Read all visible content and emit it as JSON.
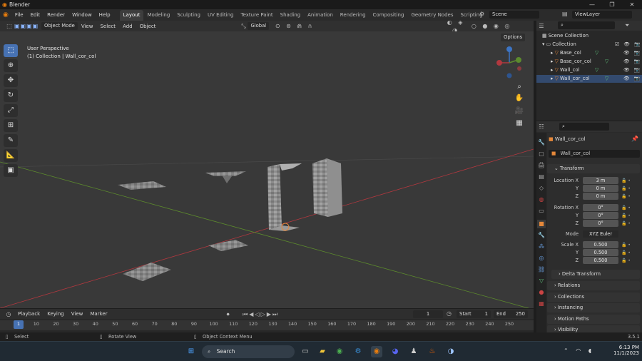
{
  "window": {
    "title": "Blender",
    "minimize": "—",
    "maximize": "❐",
    "close": "✕"
  },
  "menu": {
    "items": [
      "File",
      "Edit",
      "Render",
      "Window",
      "Help"
    ]
  },
  "workspaces": {
    "tabs": [
      "Layout",
      "Modeling",
      "Sculpting",
      "UV Editing",
      "Texture Paint",
      "Shading",
      "Animation",
      "Rendering",
      "Compositing",
      "Geometry Nodes",
      "Scripting"
    ],
    "active": "Layout",
    "add": "+"
  },
  "scene": {
    "name": "Scene",
    "view_layer": "ViewLayer"
  },
  "viewport_header": {
    "mode": "Object Mode",
    "menus": [
      "View",
      "Select",
      "Add",
      "Object"
    ],
    "orientation": "Global",
    "options": "Options"
  },
  "viewport": {
    "perspective": "User Perspective",
    "collection_info": "(1) Collection | Wall_cor_col",
    "gizmo_labels": {
      "z": "Z",
      "y": "Y",
      "x": "X"
    }
  },
  "outliner": {
    "root": "Scene Collection",
    "collection": "Collection",
    "objects": [
      "Base_col",
      "Base_cor_col",
      "Wall_col",
      "Wall_cor_col"
    ]
  },
  "properties": {
    "object_name": "Wall_cor_col",
    "object_field": "Wall_cor_col",
    "transform": {
      "title": "Transform",
      "location": {
        "label": "Location",
        "axes": [
          "X",
          "Y",
          "Z"
        ],
        "values": [
          "3 m",
          "0 m",
          "0 m"
        ]
      },
      "rotation": {
        "label": "Rotation",
        "axes": [
          "X",
          "Y",
          "Z"
        ],
        "values": [
          "0°",
          "0°",
          "0°"
        ]
      },
      "mode": {
        "label": "Mode",
        "value": "XYZ Euler"
      },
      "scale": {
        "label": "Scale",
        "axes": [
          "X",
          "Y",
          "Z"
        ],
        "values": [
          "0.500",
          "0.500",
          "0.500"
        ]
      }
    },
    "delta_transform": "Delta Transform",
    "panels": [
      "Relations",
      "Collections",
      "Instancing",
      "Motion Paths",
      "Visibility"
    ]
  },
  "timeline": {
    "menus": [
      "Playback",
      "Keying",
      "View",
      "Marker"
    ],
    "current_frame": "1",
    "start_label": "Start",
    "start": "1",
    "end_label": "End",
    "end": "250",
    "ticks": [
      "1",
      "10",
      "20",
      "30",
      "40",
      "50",
      "60",
      "70",
      "80",
      "90",
      "100",
      "110",
      "120",
      "130",
      "140",
      "150",
      "160",
      "170",
      "180",
      "190",
      "200",
      "210",
      "220",
      "230",
      "240",
      "250"
    ]
  },
  "statusbar": {
    "select": "Select",
    "rotate": "Rotate View",
    "context": "Object Context Menu",
    "version": "3.5.1"
  },
  "taskbar": {
    "search": "Search",
    "time": "6:13 PM",
    "date": "11/1/2023"
  },
  "colors": {
    "accent": "#4772b3",
    "x_axis": "#b2383f",
    "y_axis": "#5c8a2d",
    "z_axis": "#3c74c4",
    "selected": "#e5883a"
  }
}
